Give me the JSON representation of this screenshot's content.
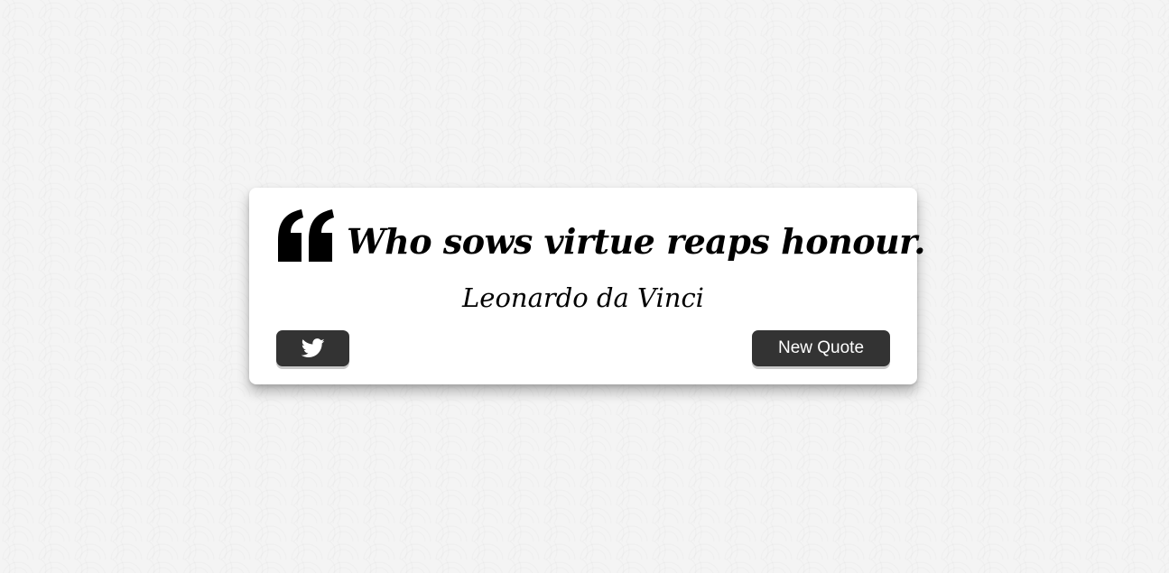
{
  "quote": {
    "text": "Who sows virtue reaps honour.",
    "author": "Leonardo da Vinci",
    "icon": "quote-left-icon"
  },
  "actions": {
    "tweet_icon": "twitter-icon",
    "new_quote_label": "New Quote"
  },
  "colors": {
    "button_bg": "#333333",
    "button_text": "#ffffff",
    "card_bg": "#ffffff",
    "page_bg": "#f4f4f4",
    "text": "#000000"
  }
}
